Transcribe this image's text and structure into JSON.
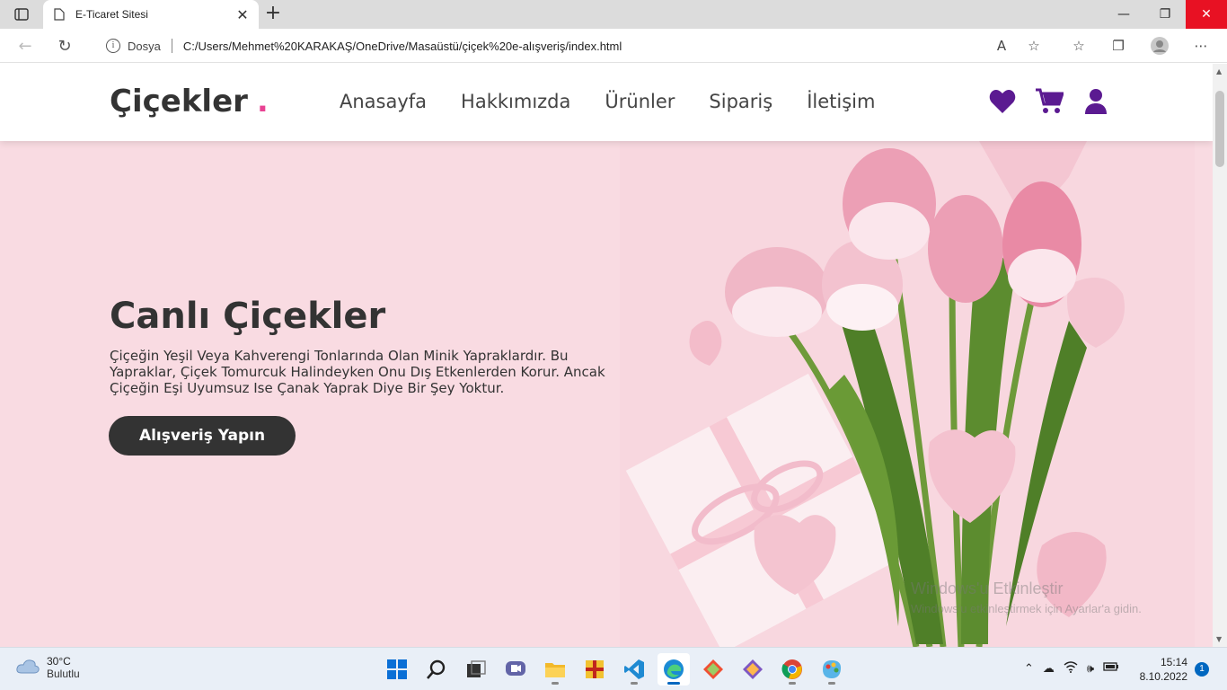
{
  "browser": {
    "tab_title": "E-Ticaret Sitesi",
    "new_tab_label": "+",
    "window_buttons": [
      "—",
      "❐",
      "✕"
    ],
    "scheme_label": "Dosya",
    "url": "C:/Users/Mehmet%20KARAKAŞ/OneDrive/Masaüstü/çiçek%20e-alışveriş/index.html"
  },
  "site": {
    "logo_text": "Çiçekler",
    "logo_dot": ".",
    "nav": [
      "Anasayfa",
      "Hakkımızda",
      "Ürünler",
      "Sipariş",
      "İletişim"
    ],
    "header_icons": [
      "heart-icon",
      "cart-icon",
      "user-icon"
    ],
    "accent_color": "#e84393",
    "icon_color": "#5b1a91"
  },
  "hero": {
    "title": "Canlı Çiçekler",
    "text": "Çiçeğin Yeşil Veya Kahverengi Tonlarında Olan Minik Yapraklardır. Bu Yapraklar, Çiçek Tomurcuk Halindeyken Onu Dış Etkenlerden Korur. Ancak Çiçeğin Eşi Uyumsuz Ise Çanak Yaprak Diye Bir Şey Yoktur.",
    "button": "Alışveriş Yapın"
  },
  "watermark": {
    "line1": "Windows'u Etkinleştir",
    "line2": "Windows'u etkinleştirmek için Ayarlar'a gidin."
  },
  "taskbar": {
    "temperature": "30°C",
    "condition": "Bulutlu",
    "time": "15:14",
    "date": "8.10.2022",
    "notifications": "1"
  }
}
